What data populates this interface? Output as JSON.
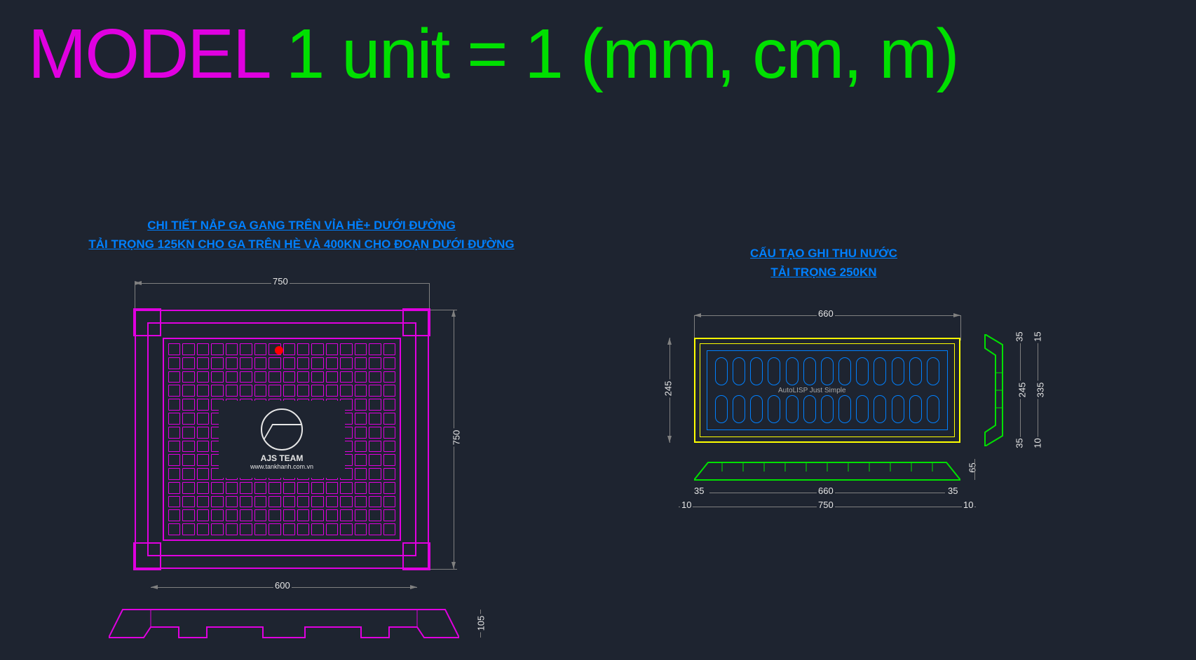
{
  "header": {
    "model": "MODEL",
    "unit": " 1 unit = 1 (mm, cm, m)"
  },
  "left": {
    "title1": "CHI TIẾT NẮP GA GANG TRÊN VỈA HÈ+ DƯỚI ĐƯỜNG",
    "title2": "TẢI TRỌNG 125KN CHO GA TRÊN HÈ VÀ 400KN CHO ĐOẠN DƯỚI ĐƯỜNG",
    "team": "AJS TEAM",
    "web": "www.tankhanh.com.vn",
    "dims": {
      "top750": "750",
      "right750": "750",
      "bottom600": "600",
      "side105": "105"
    }
  },
  "right": {
    "title1": "CẤU TẠO GHI THU NƯỚC",
    "title2": "TẢI TRỌNG 250KN",
    "watermark": "AutoLISP Just Simple",
    "dims": {
      "top660": "660",
      "left245": "245",
      "profile_660": "660",
      "profile_750": "750",
      "profile_35a": "35",
      "profile_35b": "35",
      "profile_10a": "10",
      "profile_10b": "10",
      "profile_65": "65",
      "side_35a": "35",
      "side_35b": "35",
      "side_15": "15",
      "side_10": "10",
      "side_245": "245",
      "side_335": "335"
    }
  }
}
